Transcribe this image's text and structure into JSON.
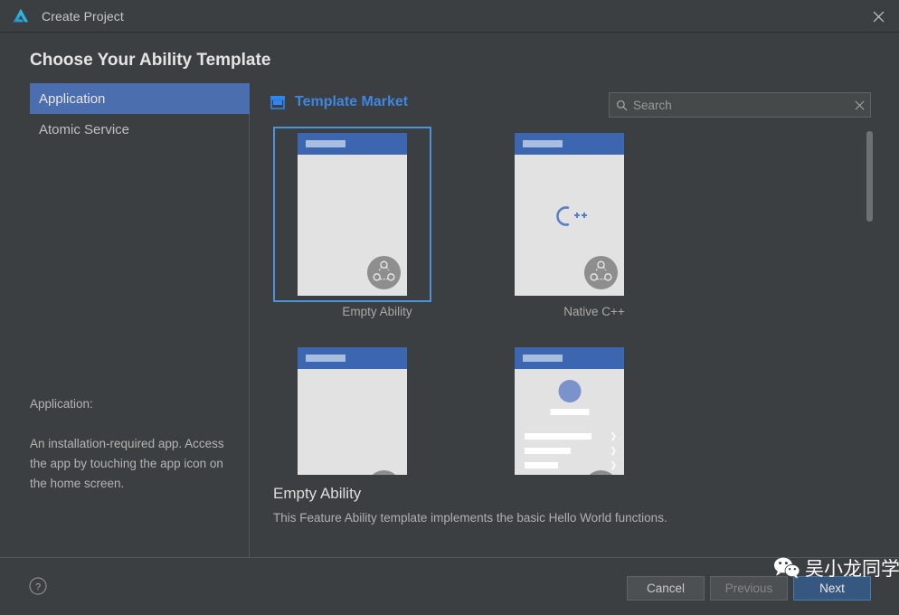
{
  "window": {
    "title": "Create Project",
    "logo_icon": "deveco-studio-logo",
    "close_icon": "close-icon"
  },
  "page": {
    "heading": "Choose Your Ability Template"
  },
  "sidebar": {
    "items": [
      {
        "label": "Application",
        "selected": true
      },
      {
        "label": "Atomic Service",
        "selected": false
      }
    ],
    "description": {
      "heading": "Application:",
      "body": "An installation-required app. Access the app by touching the app icon on the home screen."
    }
  },
  "market": {
    "icon": "store-icon",
    "label": "Template Market"
  },
  "search": {
    "icon": "search-icon",
    "placeholder": "Search",
    "value": "",
    "clear_icon": "close-icon"
  },
  "templates": [
    {
      "name": "Empty Ability",
      "selected": true,
      "preview": "empty",
      "badge_icon": "feature-ability-icon"
    },
    {
      "name": "Native C++",
      "selected": false,
      "preview": "cpp",
      "badge_icon": "feature-ability-icon",
      "center_icon": "cpp-logo-icon"
    },
    {
      "name": "",
      "selected": false,
      "preview": "empty",
      "badge_icon": "feature-ability-icon"
    },
    {
      "name": "",
      "selected": false,
      "preview": "profile",
      "badge_icon": "feature-ability-icon"
    }
  ],
  "selected_template": {
    "name": "Empty Ability",
    "description": "This Feature Ability template implements the basic Hello World functions."
  },
  "footer": {
    "help_icon": "help-icon",
    "cancel_label": "Cancel",
    "previous_label": "Previous",
    "next_label": "Next"
  },
  "watermark": {
    "icon": "wechat-icon",
    "text": "吴小龙同学"
  },
  "colors": {
    "background": "#3c3f41",
    "accent_blue": "#4b6eaf",
    "link_blue": "#3e86e0",
    "selection_border": "#4f91d6",
    "primary_button": "#365880",
    "phone_header": "#3d66b0"
  }
}
